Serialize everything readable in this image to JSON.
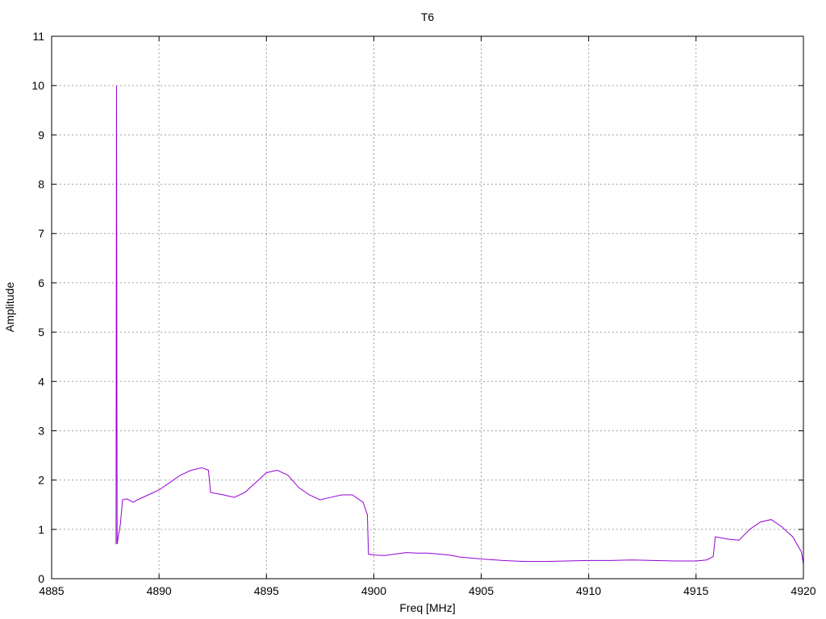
{
  "chart_data": {
    "type": "line",
    "title": "T6",
    "xlabel": "Freq [MHz]",
    "ylabel": "Amplitude",
    "xlim": [
      4885,
      4920
    ],
    "ylim": [
      0,
      11
    ],
    "xticks": [
      4885,
      4890,
      4895,
      4900,
      4905,
      4910,
      4915,
      4920
    ],
    "yticks": [
      0,
      1,
      2,
      3,
      4,
      5,
      6,
      7,
      8,
      9,
      10,
      11
    ],
    "grid": true,
    "legend": "none",
    "series": [
      {
        "color": "#9400d3",
        "points": [
          [
            4888.0,
            0.7
          ],
          [
            4888.02,
            10.0
          ],
          [
            4888.05,
            0.7
          ],
          [
            4888.1,
            0.85
          ],
          [
            4888.2,
            1.1
          ],
          [
            4888.3,
            1.6
          ],
          [
            4888.5,
            1.62
          ],
          [
            4888.8,
            1.55
          ],
          [
            4889.0,
            1.6
          ],
          [
            4889.5,
            1.7
          ],
          [
            4890.0,
            1.8
          ],
          [
            4890.5,
            1.95
          ],
          [
            4891.0,
            2.1
          ],
          [
            4891.5,
            2.2
          ],
          [
            4892.0,
            2.25
          ],
          [
            4892.3,
            2.2
          ],
          [
            4892.4,
            1.75
          ],
          [
            4893.0,
            1.7
          ],
          [
            4893.5,
            1.65
          ],
          [
            4894.0,
            1.75
          ],
          [
            4894.5,
            1.95
          ],
          [
            4895.0,
            2.15
          ],
          [
            4895.5,
            2.2
          ],
          [
            4896.0,
            2.1
          ],
          [
            4896.5,
            1.85
          ],
          [
            4897.0,
            1.7
          ],
          [
            4897.5,
            1.6
          ],
          [
            4898.0,
            1.65
          ],
          [
            4898.5,
            1.7
          ],
          [
            4899.0,
            1.7
          ],
          [
            4899.5,
            1.55
          ],
          [
            4899.7,
            1.3
          ],
          [
            4899.75,
            0.5
          ],
          [
            4900.0,
            0.48
          ],
          [
            4900.5,
            0.47
          ],
          [
            4901.0,
            0.5
          ],
          [
            4901.5,
            0.53
          ],
          [
            4902.0,
            0.52
          ],
          [
            4902.5,
            0.52
          ],
          [
            4903.0,
            0.5
          ],
          [
            4903.5,
            0.48
          ],
          [
            4904.0,
            0.44
          ],
          [
            4905.0,
            0.4
          ],
          [
            4906.0,
            0.37
          ],
          [
            4907.0,
            0.35
          ],
          [
            4908.0,
            0.35
          ],
          [
            4909.0,
            0.36
          ],
          [
            4910.0,
            0.37
          ],
          [
            4911.0,
            0.37
          ],
          [
            4912.0,
            0.38
          ],
          [
            4913.0,
            0.37
          ],
          [
            4914.0,
            0.36
          ],
          [
            4915.0,
            0.36
          ],
          [
            4915.5,
            0.38
          ],
          [
            4915.8,
            0.45
          ],
          [
            4915.9,
            0.85
          ],
          [
            4916.5,
            0.8
          ],
          [
            4917.0,
            0.78
          ],
          [
            4917.5,
            1.0
          ],
          [
            4918.0,
            1.15
          ],
          [
            4918.5,
            1.2
          ],
          [
            4919.0,
            1.05
          ],
          [
            4919.5,
            0.85
          ],
          [
            4919.9,
            0.55
          ],
          [
            4920.0,
            0.3
          ]
        ]
      }
    ]
  }
}
